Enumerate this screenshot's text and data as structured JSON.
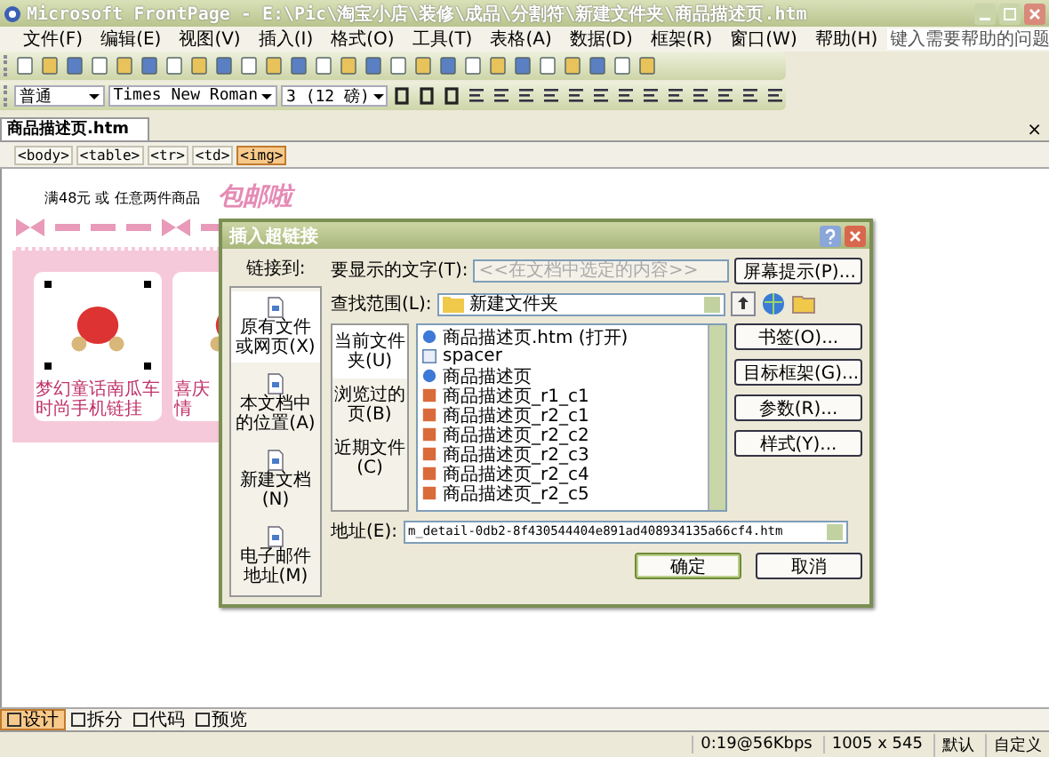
{
  "window": {
    "title": "Microsoft FrontPage - E:\\Pic\\淘宝小店\\装修\\成品\\分割符\\新建文件夹\\商品描述页.htm"
  },
  "menu": [
    "文件(F)",
    "编辑(E)",
    "视图(V)",
    "插入(I)",
    "格式(O)",
    "工具(T)",
    "表格(A)",
    "数据(D)",
    "框架(R)",
    "窗口(W)",
    "帮助(H)"
  ],
  "help_search": {
    "placeholder": "键入需要帮助的问题"
  },
  "format_toolbar": {
    "style": "普通",
    "font": "Times New Roman",
    "size": "3 (12 磅)"
  },
  "document_tab": {
    "label": "商品描述页.htm",
    "close": "×"
  },
  "tag_bar": [
    {
      "label": "<body>",
      "selected": false
    },
    {
      "label": "<table>",
      "selected": false
    },
    {
      "label": "<tr>",
      "selected": false
    },
    {
      "label": "<td>",
      "selected": false
    },
    {
      "label": "<img>",
      "selected": true
    }
  ],
  "page": {
    "promo_text": "满48元 或 任意两件商品",
    "promo_badge": "包邮啦",
    "products": [
      {
        "caption": [
          "梦幻童话南瓜车",
          "时尚手机链挂"
        ],
        "selected": true
      },
      {
        "caption": [
          "喜庆",
          "情"
        ],
        "selected": false
      }
    ]
  },
  "dialog": {
    "title": "插入超链接",
    "link_to_label": "链接到:",
    "link_types": [
      {
        "label": "原有文件或网页(X)",
        "selected": true
      },
      {
        "label": "本文档中的位置(A)",
        "selected": false
      },
      {
        "label": "新建文档(N)",
        "selected": false
      },
      {
        "label": "电子邮件地址(M)",
        "selected": false
      }
    ],
    "display_text": {
      "label": "要显示的文字(T):",
      "value": "<<在文档中选定的内容>>",
      "disabled": true
    },
    "screen_tip_button": "屏幕提示(P)...",
    "look_in": {
      "label": "查找范围(L):",
      "value": "新建文件夹"
    },
    "locations": [
      {
        "label": "当前文件夹(U)",
        "selected": true
      },
      {
        "label": "浏览过的页(B)",
        "selected": false
      },
      {
        "label": "近期文件(C)",
        "selected": false
      }
    ],
    "files": [
      {
        "name": "商品描述页.htm (打开)",
        "kind": "page"
      },
      {
        "name": "spacer",
        "kind": "spacer"
      },
      {
        "name": "商品描述页",
        "kind": "page"
      },
      {
        "name": "商品描述页_r1_c1",
        "kind": "image"
      },
      {
        "name": "商品描述页_r2_c1",
        "kind": "image"
      },
      {
        "name": "商品描述页_r2_c2",
        "kind": "image"
      },
      {
        "name": "商品描述页_r2_c3",
        "kind": "image"
      },
      {
        "name": "商品描述页_r2_c4",
        "kind": "image"
      },
      {
        "name": "商品描述页_r2_c5",
        "kind": "image"
      }
    ],
    "side_buttons": [
      "书签(O)...",
      "目标框架(G)...",
      "参数(R)...",
      "样式(Y)..."
    ],
    "address": {
      "label": "地址(E):",
      "value": "m_detail-0db2-8f430544404e891ad408934135a66cf4.htm"
    },
    "ok_button": "确定",
    "cancel_button": "取消"
  },
  "view_tabs": [
    {
      "label": "设计",
      "selected": true
    },
    {
      "label": "拆分",
      "selected": false
    },
    {
      "label": "代码",
      "selected": false
    },
    {
      "label": "预览",
      "selected": false
    }
  ],
  "status_bar": [
    "0:19@56Kbps",
    "1005 x 545",
    "默认",
    "自定义"
  ]
}
